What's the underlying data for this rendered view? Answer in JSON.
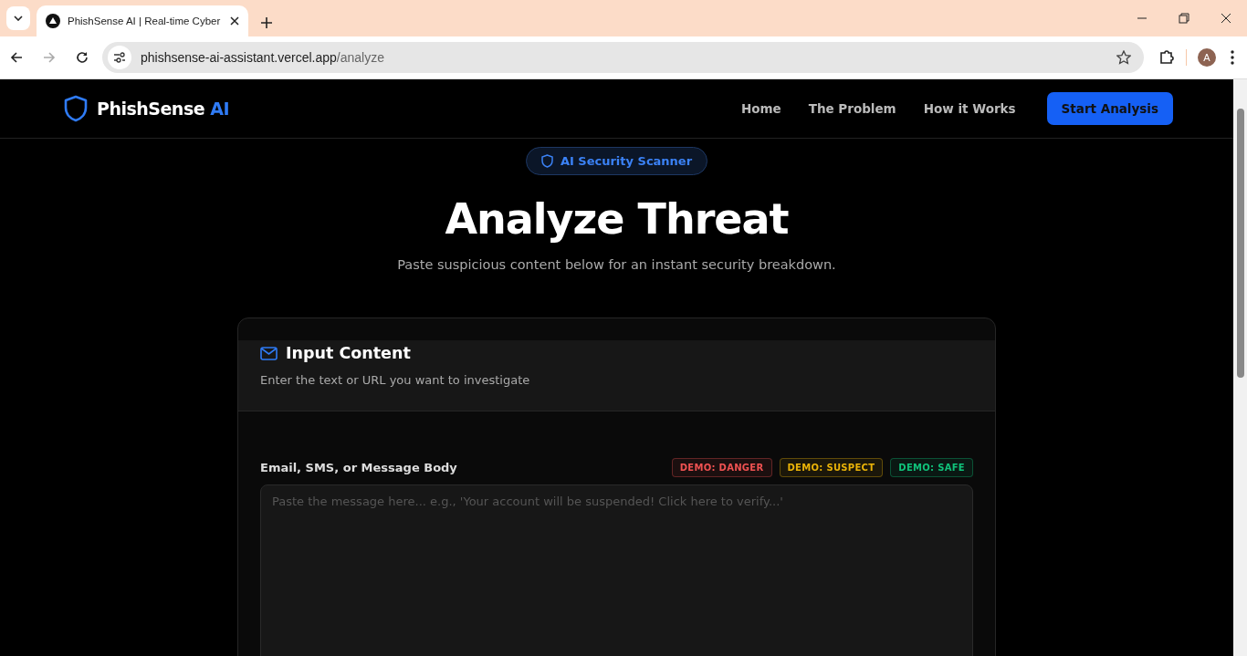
{
  "browser": {
    "tab_title": "PhishSense AI | Real-time Cyber",
    "url_host": "phishsense-ai-assistant.vercel.app",
    "url_path": "/analyze",
    "profile_initial": "A"
  },
  "header": {
    "brand": "PhishSense",
    "brand_accent": "AI",
    "nav": [
      "Home",
      "The Problem",
      "How it Works"
    ],
    "cta": "Start Analysis"
  },
  "hero": {
    "badge": "AI Security Scanner",
    "title": "Analyze Threat",
    "subtitle": "Paste suspicious content below for an instant security breakdown."
  },
  "card": {
    "title": "Input Content",
    "description": "Enter the text or URL you want to investigate",
    "field_label": "Email, SMS, or Message Body",
    "demos": [
      {
        "label": "DEMO: DANGER",
        "color": "#f05252"
      },
      {
        "label": "DEMO: SUSPECT",
        "color": "#eab308"
      },
      {
        "label": "DEMO: SAFE",
        "color": "#10c27a"
      }
    ],
    "placeholder": "Paste the message here... e.g., 'Your account will be suspended! Click here to verify...'"
  }
}
